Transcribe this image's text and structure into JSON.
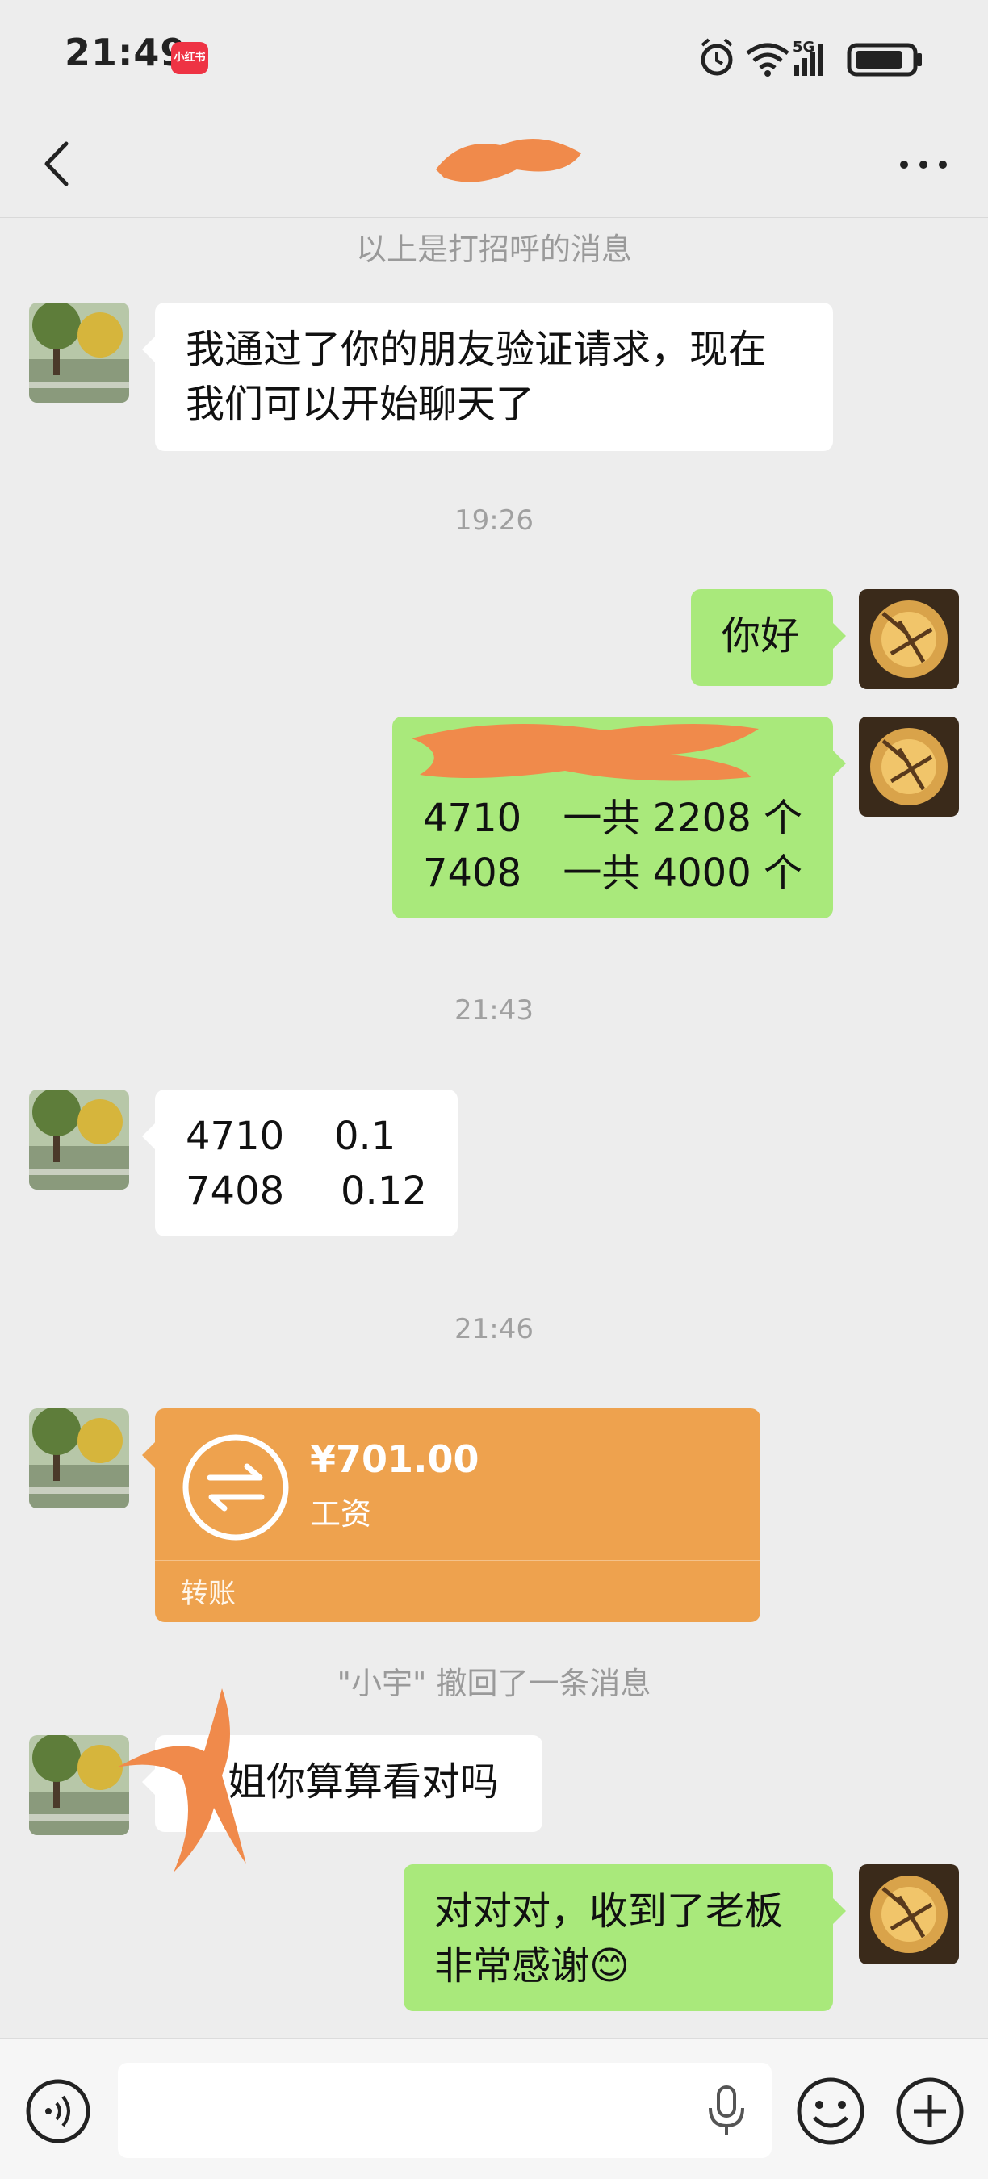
{
  "status_bar": {
    "time": "21:49",
    "app_badge": "小红书",
    "network": "5G"
  },
  "nav": {
    "back_icon": "chevron-left-icon",
    "more_icon": "more-dots-icon"
  },
  "messages": {
    "greeting_notice": "以上是打招呼的消息",
    "msg1": {
      "line1": "我通过了你的朋友验证请求，现在",
      "line2": "我们可以开始聊天了"
    },
    "time1": "19:26",
    "msg2": "你好",
    "msg3": {
      "row1_code": "4710",
      "row1_total": "一共 2208 个",
      "row2_code": "7408",
      "row2_total": "一共 4000 个"
    },
    "time2": "21:43",
    "msg4": {
      "row1_code": "4710",
      "row1_rate": "0.1",
      "row2_code": "7408",
      "row2_rate": "0.12"
    },
    "time3": "21:46",
    "transfer": {
      "amount": "¥701.00",
      "note": "工资",
      "label": "转账"
    },
    "recall_notice": "\"小宇\" 撤回了一条消息",
    "msg5": "姐你算算看对吗",
    "msg6": {
      "line1": "对对对，收到了老板",
      "line2": "非常感谢😊"
    }
  },
  "input_bar": {
    "placeholder": "",
    "voice_icon": "voice-icon",
    "mic_icon": "microphone-icon",
    "emoji_icon": "emoji-icon",
    "plus_icon": "plus-icon"
  },
  "colors": {
    "background": "#ededed",
    "outgoing_bubble": "#a9e97b",
    "incoming_bubble": "#ffffff",
    "transfer_card": "#eea24e",
    "redaction": "#f08a4b"
  }
}
